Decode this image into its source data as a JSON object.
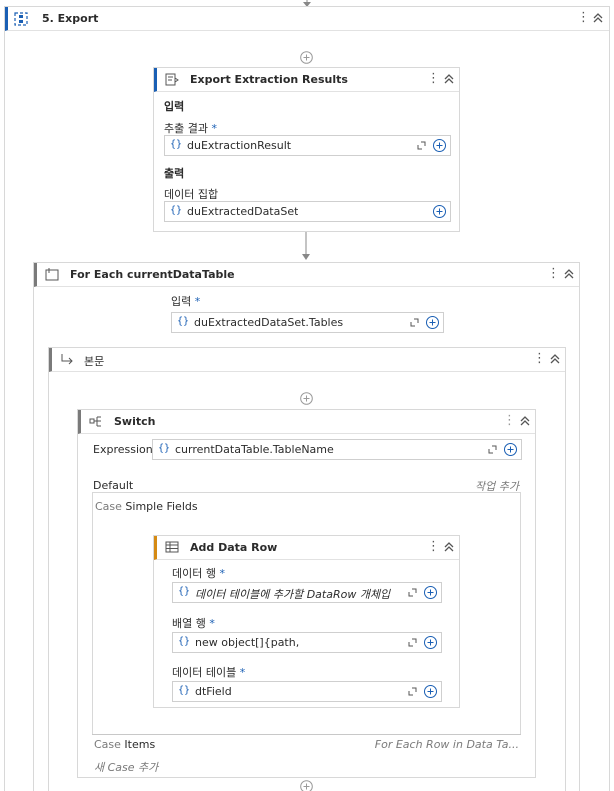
{
  "sequence": {
    "title": "5. Export"
  },
  "export_activity": {
    "title": "Export Extraction Results",
    "input_section": "입력",
    "field1_label": "추출 결과",
    "field1_required": "*",
    "field1_value": "duExtractionResult",
    "output_section": "출력",
    "field2_label": "데이터 집합",
    "field2_value": "duExtractedDataSet"
  },
  "for_each": {
    "title": "For Each currentDataTable",
    "input_label": "입력",
    "input_required": "*",
    "input_value": "duExtractedDataSet.Tables"
  },
  "body": {
    "title": "본문"
  },
  "switch": {
    "title": "Switch",
    "expression_label": "Expression",
    "expression_value": "currentDataTable.TableName",
    "default_label": "Default",
    "add_activity": "작업 추가",
    "case_label": "Case",
    "case1_name": "Simple Fields",
    "case2_name": "Items",
    "case2_summary": "For Each Row in Data Ta...",
    "new_case": "새 Case 추가"
  },
  "add_data_row": {
    "title": "Add Data Row",
    "field1_label": "데이터 행",
    "field1_required": "*",
    "field1_placeholder": "데이터 테이블에 추가할 DataRow 개체입",
    "field2_label": "배열 행",
    "field2_required": "*",
    "field2_value": "new object[]{path,",
    "field3_label": "데이터 테이블",
    "field3_required": "*",
    "field3_value": "dtField"
  },
  "colors": {
    "accent_blue": "#1a5fb4",
    "accent_orange": "#d58a13"
  }
}
